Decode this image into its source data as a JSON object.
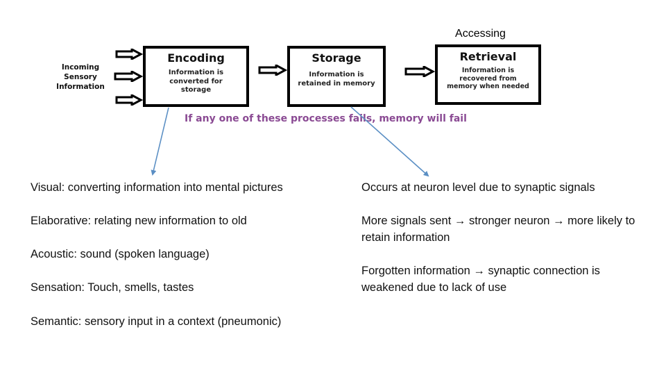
{
  "diagram": {
    "input_label": [
      "Incoming",
      "Sensory",
      "Information"
    ],
    "stages": [
      {
        "title": "Encoding",
        "description": [
          "Information is",
          "converted for",
          "storage"
        ]
      },
      {
        "title": "Storage",
        "description": [
          "Information is",
          "retained in memory"
        ]
      },
      {
        "title": "Retrieval",
        "description": [
          "Information is",
          "recovered from",
          "memory when needed"
        ]
      }
    ],
    "retrieval_caption": "Accessing",
    "warning": "If any one of these processes fails, memory will fail",
    "colors": {
      "warning_text": "#8a4a93",
      "connector_arrow": "#5b8fc4",
      "box_border": "#000000"
    }
  },
  "encoding_types": [
    "Visual: converting information into mental pictures",
    "Elaborative: relating new information to old",
    "Acoustic: sound (spoken language)",
    "Sensation: Touch, smells, tastes",
    "Semantic: sensory input in a context (pneumonic)"
  ],
  "storage_notes": [
    "Occurs at neuron level due to synaptic signals",
    "More signals sent → stronger neuron → more likely to retain information",
    "Forgotten information → synaptic connection is weakened due to lack of use"
  ]
}
